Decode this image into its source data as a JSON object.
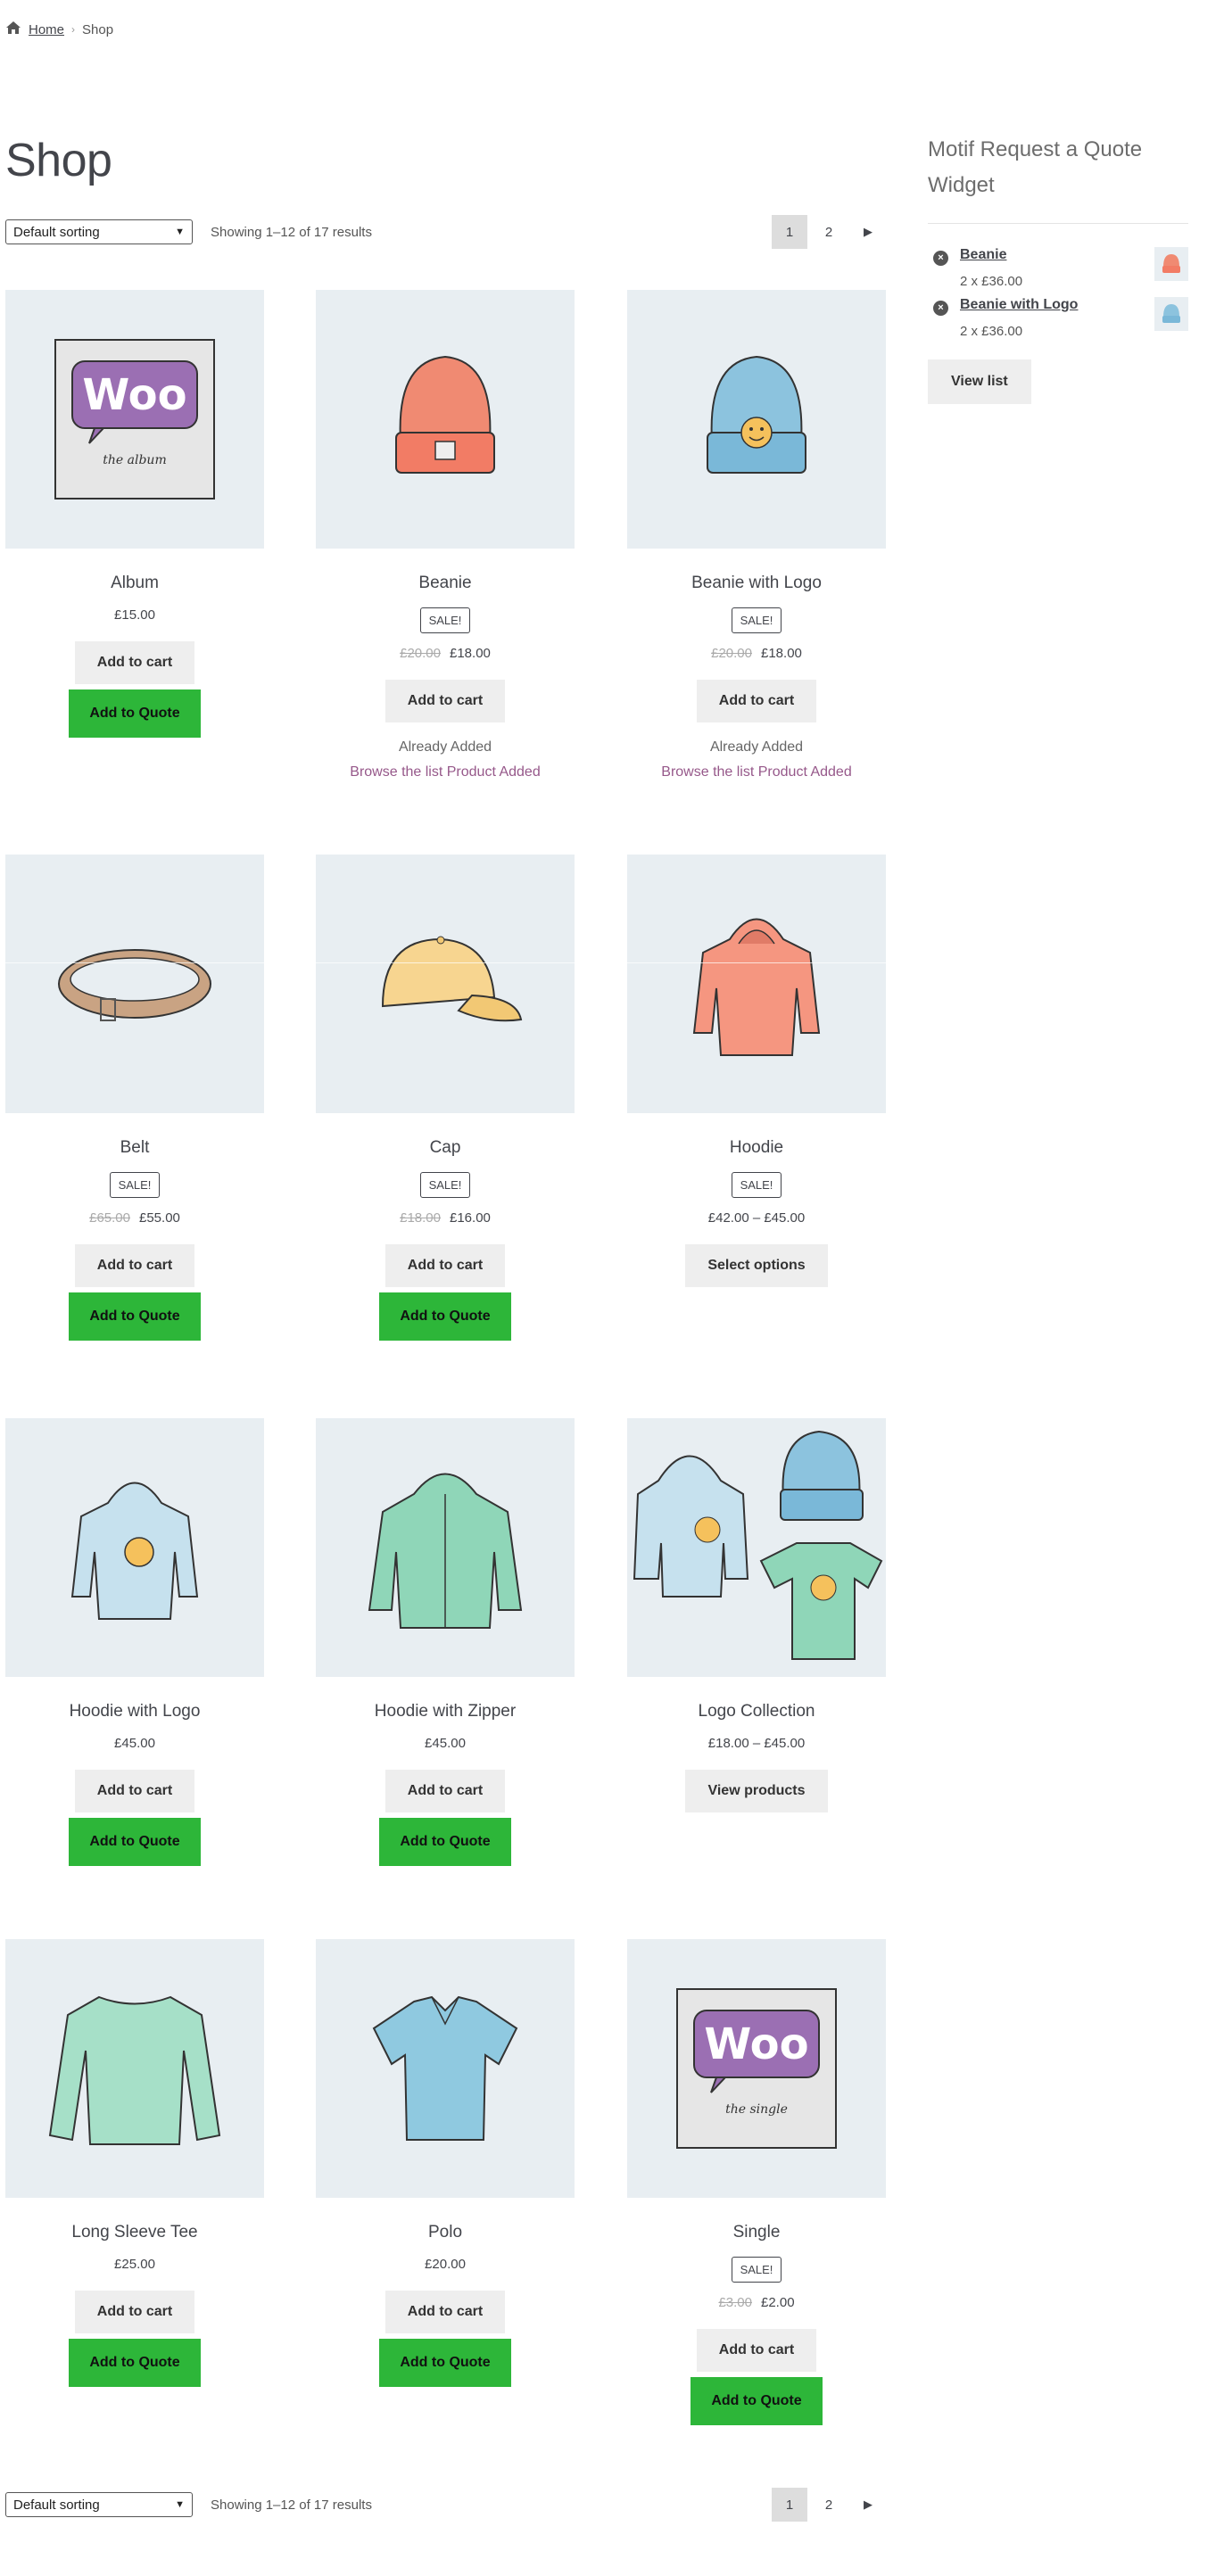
{
  "breadcrumb": {
    "home": "Home",
    "current": "Shop"
  },
  "page_title": "Shop",
  "sorting": {
    "selected": "Default sorting"
  },
  "result_count": "Showing 1–12 of 17 results",
  "pagination": {
    "pages": [
      "1",
      "2"
    ],
    "current": "1",
    "next": "→"
  },
  "products": [
    {
      "title": "Album",
      "price": "£15.00",
      "add_to_cart": "Add to cart",
      "add_to_quote": "Add to Quote",
      "image": "album-art"
    },
    {
      "title": "Beanie",
      "badge": "SALE!",
      "old_price": "£20.00",
      "price": "£18.00",
      "add_to_cart": "Add to cart",
      "already_added": "Already Added",
      "browse": "Browse the list Product Added",
      "image": "beanie"
    },
    {
      "title": "Beanie with Logo",
      "badge": "SALE!",
      "old_price": "£20.00",
      "price": "£18.00",
      "add_to_cart": "Add to cart",
      "already_added": "Already Added",
      "browse": "Browse the list Product Added",
      "image": "beanie-logo"
    },
    {
      "title": "Belt",
      "badge": "SALE!",
      "old_price": "£65.00",
      "price": "£55.00",
      "add_to_cart": "Add to cart",
      "add_to_quote": "Add to Quote",
      "image": "belt"
    },
    {
      "title": "Cap",
      "badge": "SALE!",
      "old_price": "£18.00",
      "price": "£16.00",
      "add_to_cart": "Add to cart",
      "add_to_quote": "Add to Quote",
      "image": "cap"
    },
    {
      "title": "Hoodie",
      "badge": "SALE!",
      "price": "£42.00 – £45.00",
      "add_to_cart": "Select options",
      "image": "hoodie"
    },
    {
      "title": "Hoodie with Logo",
      "price": "£45.00",
      "add_to_cart": "Add to cart",
      "add_to_quote": "Add to Quote",
      "image": "hoodie-logo"
    },
    {
      "title": "Hoodie with Zipper",
      "price": "£45.00",
      "add_to_cart": "Add to cart",
      "add_to_quote": "Add to Quote",
      "image": "hoodie-zipper"
    },
    {
      "title": "Logo Collection",
      "price": "£18.00 – £45.00",
      "add_to_cart": "View products",
      "image": "logo-collection"
    },
    {
      "title": "Long Sleeve Tee",
      "price": "£25.00",
      "add_to_cart": "Add to cart",
      "add_to_quote": "Add to Quote",
      "image": "long-sleeve"
    },
    {
      "title": "Polo",
      "price": "£20.00",
      "add_to_cart": "Add to cart",
      "add_to_quote": "Add to Quote",
      "image": "polo"
    },
    {
      "title": "Single",
      "badge": "SALE!",
      "old_price": "£3.00",
      "price": "£2.00",
      "add_to_cart": "Add to cart",
      "add_to_quote": "Add to Quote",
      "image": "single-art"
    }
  ],
  "widget": {
    "title": "Motif Request a Quote Widget",
    "items": [
      {
        "name": "Beanie",
        "qty": "2 x £36.00",
        "remove": "×"
      },
      {
        "name": "Beanie with Logo",
        "qty": "2 x £36.00",
        "remove": "×"
      }
    ],
    "view_list": "View list"
  },
  "colors": {
    "accent_green": "#2db639",
    "link_purple": "#96588a",
    "thumb_bg": "#e8eef2"
  }
}
